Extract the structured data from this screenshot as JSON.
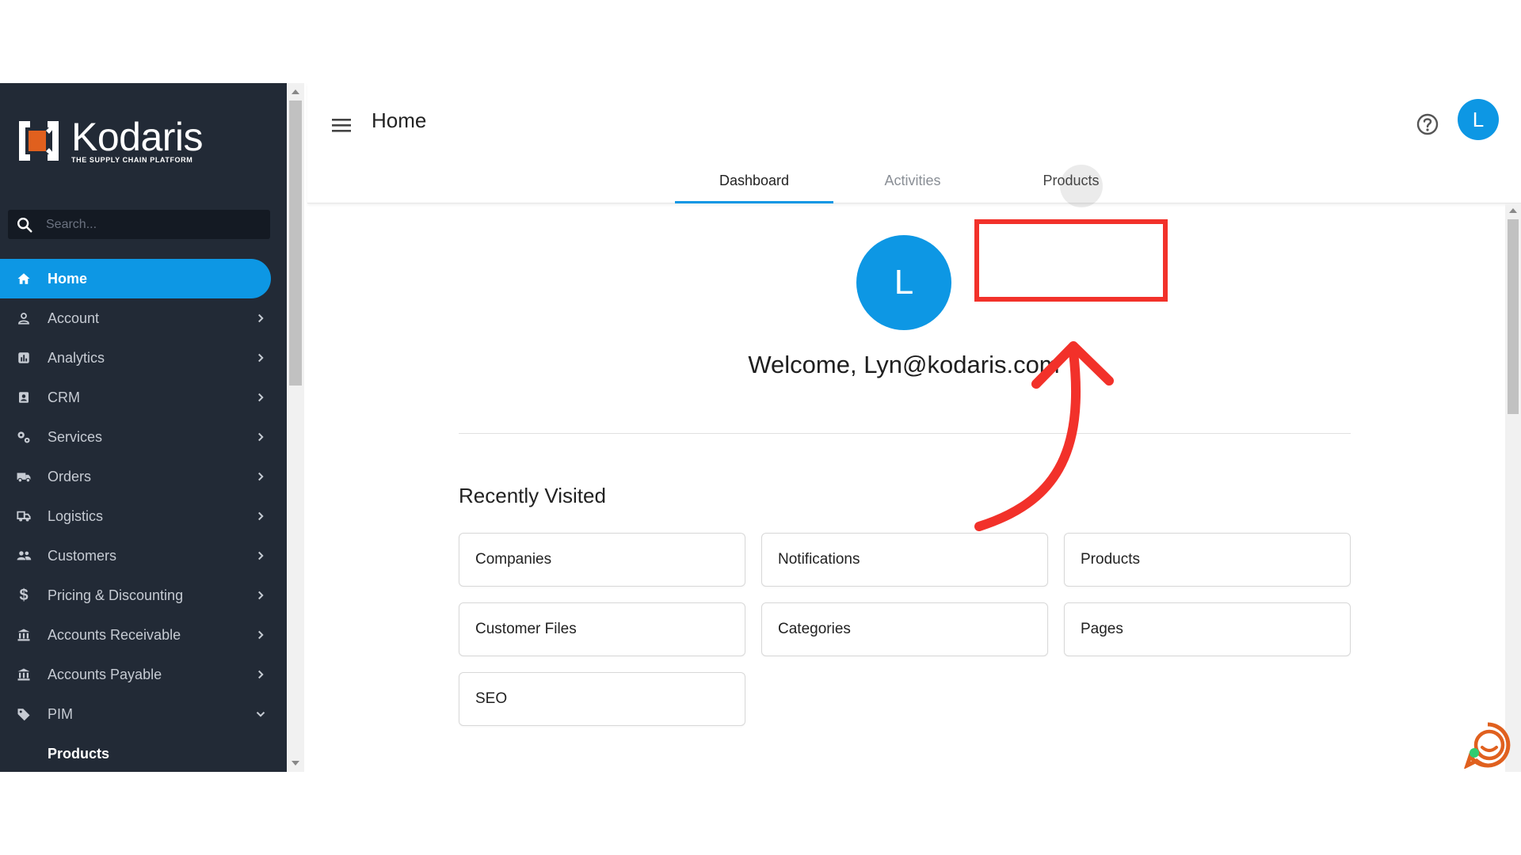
{
  "brand": {
    "name": "Kodaris",
    "tagline": "THE SUPPLY CHAIN PLATFORM",
    "accent_color": "#0d97e4",
    "logo_orange": "#e0601e"
  },
  "sidebar": {
    "search_placeholder": "Search...",
    "items": [
      {
        "label": "Home",
        "icon": "home-icon",
        "active": true
      },
      {
        "label": "Account",
        "icon": "user-icon"
      },
      {
        "label": "Analytics",
        "icon": "chart-icon"
      },
      {
        "label": "CRM",
        "icon": "contact-card-icon"
      },
      {
        "label": "Services",
        "icon": "gears-icon"
      },
      {
        "label": "Orders",
        "icon": "truck-icon"
      },
      {
        "label": "Logistics",
        "icon": "shipping-icon"
      },
      {
        "label": "Customers",
        "icon": "users-icon"
      },
      {
        "label": "Pricing & Discounting",
        "icon": "dollar-icon"
      },
      {
        "label": "Accounts Receivable",
        "icon": "bank-icon"
      },
      {
        "label": "Accounts Payable",
        "icon": "bank-icon"
      },
      {
        "label": "PIM",
        "icon": "tag-icon"
      }
    ],
    "sub_items": [
      {
        "label": "Products"
      }
    ]
  },
  "header": {
    "title": "Home",
    "avatar_letter": "L"
  },
  "tabs": [
    {
      "label": "Dashboard",
      "active": true
    },
    {
      "label": "Activities"
    },
    {
      "label": "Products"
    }
  ],
  "main": {
    "avatar_letter": "L",
    "welcome": "Welcome, Lyn@kodaris.com",
    "recent_title": "Recently Visited",
    "recent": [
      "Companies",
      "Notifications",
      "Products",
      "Customer Files",
      "Categories",
      "Pages",
      "SEO"
    ]
  },
  "annotation": {
    "highlight_color": "#f2312a"
  }
}
